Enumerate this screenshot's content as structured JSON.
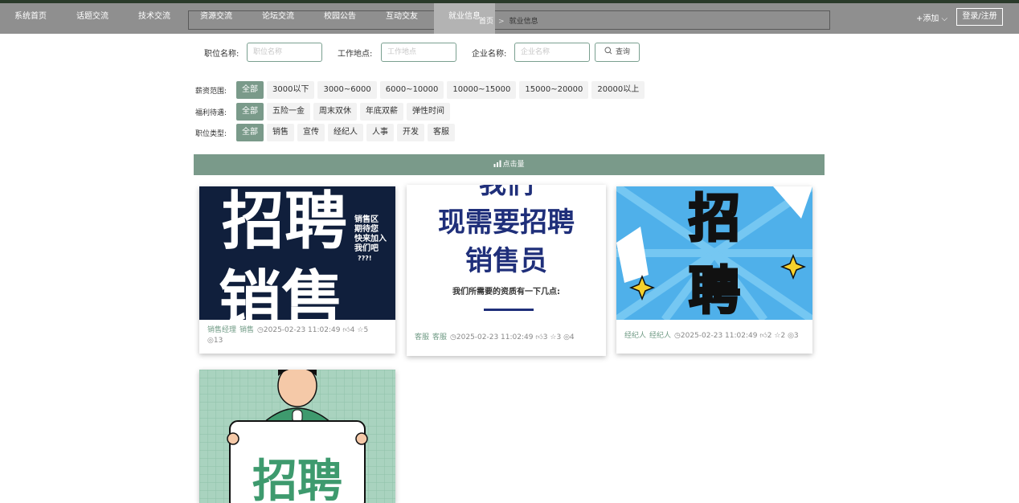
{
  "nav": {
    "items": [
      {
        "label": "系统首页"
      },
      {
        "label": "话题交流"
      },
      {
        "label": "技术交流"
      },
      {
        "label": "资源交流"
      },
      {
        "label": "论坛交流"
      },
      {
        "label": "校园公告"
      },
      {
        "label": "互动交友"
      },
      {
        "label": "就业信息"
      }
    ],
    "add_label": "+添加 ⌵",
    "login_label": "登录/注册"
  },
  "breadcrumb": {
    "home": "首页",
    "sep": ">",
    "current": "就业信息"
  },
  "search": {
    "position_label": "职位名称:",
    "position_placeholder": "职位名称",
    "location_label": "工作地点:",
    "location_placeholder": "工作地点",
    "company_label": "企业名称:",
    "company_placeholder": "企业名称",
    "button_label": "查询"
  },
  "filters": {
    "salary": {
      "label": "薪资范围:",
      "options": [
        "全部",
        "3000以下",
        "3000~6000",
        "6000~10000",
        "10000~15000",
        "15000~20000",
        "20000以上"
      ]
    },
    "welfare": {
      "label": "福利待遇:",
      "options": [
        "全部",
        "五险一金",
        "周末双休",
        "年底双薪",
        "弹性时间"
      ]
    },
    "type": {
      "label": "职位类型:",
      "options": [
        "全部",
        "销售",
        "宣传",
        "经纪人",
        "人事",
        "开发",
        "客服"
      ]
    }
  },
  "sort": {
    "label": "点击量"
  },
  "cards": [
    {
      "title": "销售经理",
      "type": "销售",
      "time": "2025-02-23 11:02:49",
      "likes": "4",
      "stars": "5",
      "views": "13",
      "image_text": [
        "招聘",
        "销售"
      ],
      "image_side": [
        "销售区",
        "期待您",
        "快来加入",
        "我们吧",
        "???!"
      ]
    },
    {
      "title": "客服",
      "type": "客服",
      "time": "2025-02-23 11:02:49",
      "likes": "3",
      "stars": "3",
      "views": "4",
      "image_text": [
        "我们",
        "现需要招聘",
        "销售员"
      ],
      "image_sub": "我们所需要的资质有一下几点:"
    },
    {
      "title": "经纪人",
      "type": "经纪人",
      "time": "2025-02-23 11:02:49",
      "likes": "2",
      "stars": "2",
      "views": "3",
      "image_text": [
        "招",
        "聘"
      ]
    },
    {
      "image_text": [
        "招聘"
      ]
    }
  ],
  "colors": {
    "accent": "#7a9a8a",
    "nav_bg": "#8f8f8f",
    "nav_active": "#b3b3b3",
    "tag": "#6f9a84"
  }
}
